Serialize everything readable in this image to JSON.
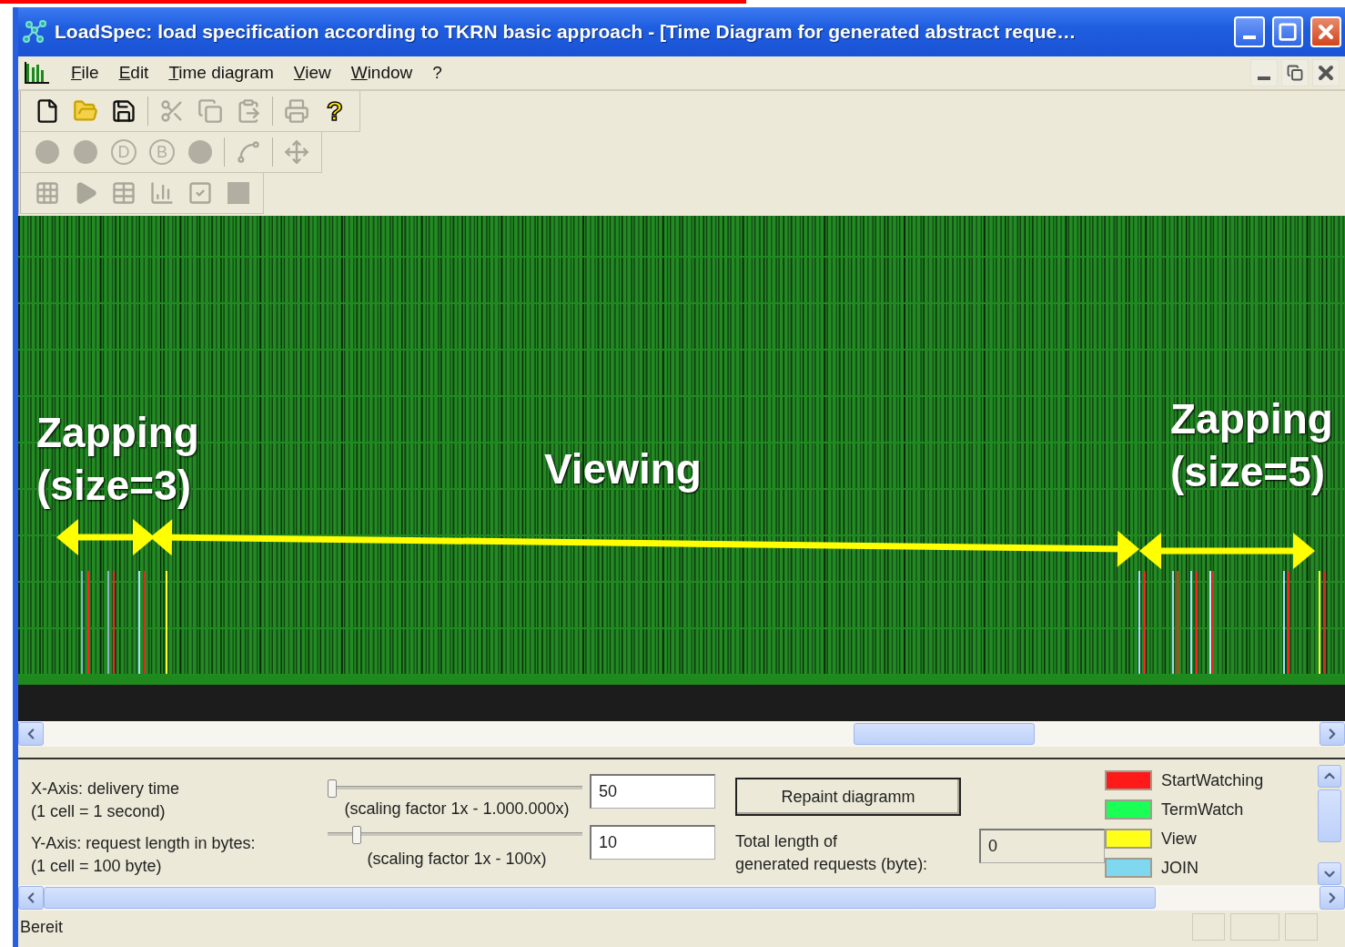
{
  "title_bar": {
    "title": "LoadSpec: load specification according to TKRN basic approach - [Time Diagram for generated abstract reque…",
    "buttons": [
      {
        "kind": "minimize"
      },
      {
        "kind": "maximize"
      },
      {
        "kind": "close"
      }
    ]
  },
  "menu_bar": {
    "items": [
      "File",
      "Edit",
      "Time diagram",
      "View",
      "Window",
      "?"
    ],
    "document_buttons": [
      {
        "kind": "minimize"
      },
      {
        "kind": "restore"
      },
      {
        "kind": "close"
      }
    ]
  },
  "toolbars": [
    [
      {
        "kind": "new",
        "disabled": false
      },
      {
        "kind": "open",
        "disabled": false
      },
      {
        "kind": "save",
        "disabled": false
      },
      {
        "kind": "separator"
      },
      {
        "kind": "cut",
        "disabled": true
      },
      {
        "kind": "copy",
        "disabled": true
      },
      {
        "kind": "paste",
        "disabled": true
      },
      {
        "kind": "separator"
      },
      {
        "kind": "print",
        "disabled": true
      },
      {
        "kind": "help",
        "label": "?",
        "disabled": false
      }
    ],
    [
      {
        "kind": "dot",
        "disabled": true
      },
      {
        "kind": "dot",
        "disabled": true
      },
      {
        "kind": "letter",
        "label": "D",
        "disabled": true
      },
      {
        "kind": "letter",
        "label": "B",
        "disabled": true
      },
      {
        "kind": "dot",
        "disabled": true
      },
      {
        "kind": "separator"
      },
      {
        "kind": "curve",
        "disabled": true
      },
      {
        "kind": "separator"
      },
      {
        "kind": "move",
        "disabled": true
      }
    ],
    [
      {
        "kind": "grid",
        "disabled": true
      },
      {
        "kind": "play",
        "disabled": true
      },
      {
        "kind": "table",
        "disabled": true
      },
      {
        "kind": "chart",
        "disabled": true
      },
      {
        "kind": "checkbox",
        "disabled": true
      },
      {
        "kind": "square",
        "disabled": true
      }
    ]
  ],
  "diagram": {
    "annotations": [
      {
        "text": "Zapping\n(size=3)"
      },
      {
        "text": "Viewing"
      },
      {
        "text": "Zapping\n(size=5)"
      }
    ]
  },
  "panel": {
    "x_axis": {
      "label": "X-Axis: delivery time",
      "unit": "(1 cell = 1 second)"
    },
    "y_axis": {
      "label": "Y-Axis: request length in bytes:",
      "unit": "(1 cell = 100 byte)"
    },
    "sliders": [
      {
        "level": 0.0,
        "range_label": "(scaling factor 1x - 1.000.000x)",
        "value": "50"
      },
      {
        "level": 0.1,
        "range_label": "(scaling factor 1x - 100x)",
        "value": "10"
      }
    ],
    "repaint_button": "Repaint diagramm",
    "total_label": "Total length of\ngenerated requests (byte):",
    "total_value": "0",
    "legend": [
      {
        "label": "StartWatching",
        "color": "#ff1a1a"
      },
      {
        "label": "TermWatch",
        "color": "#1aff55"
      },
      {
        "label": "View",
        "color": "#ffff1a"
      },
      {
        "label": "JOIN",
        "color": "#7fd8f0"
      }
    ]
  },
  "status_bar": {
    "text": "Bereit"
  }
}
